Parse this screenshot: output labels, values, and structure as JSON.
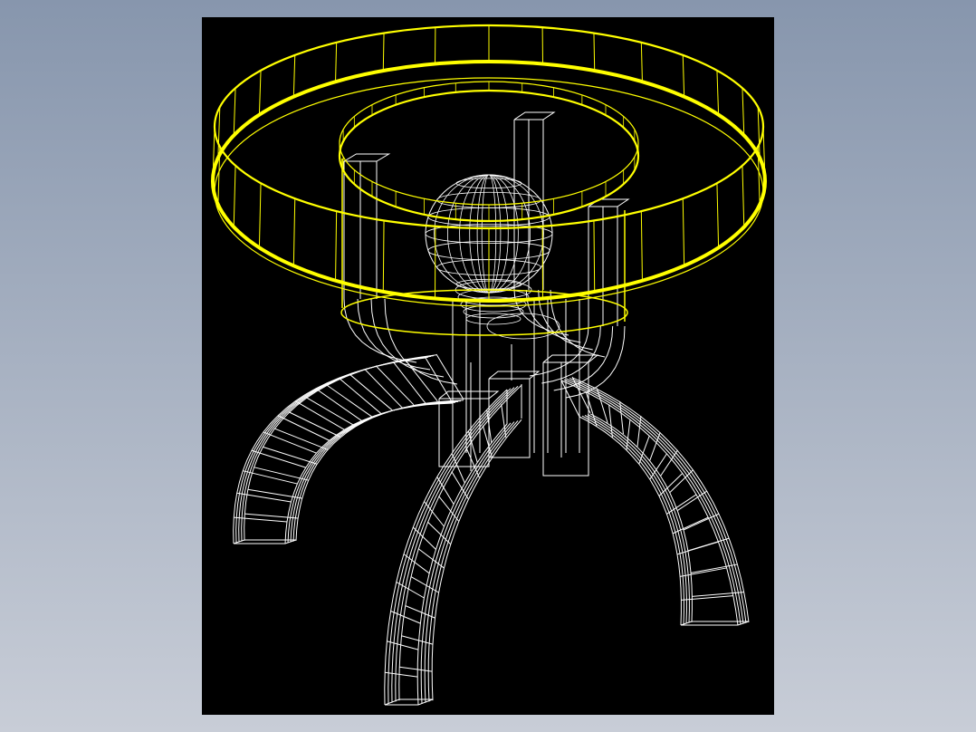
{
  "drawing": {
    "subject": "wireframe-round-side-table",
    "colors": {
      "background_top": "#8796ad",
      "background_bottom": "#c8cdd7",
      "viewport": "#000000",
      "wireframe": "#ffffff",
      "selection": "#ffff00"
    },
    "parts": [
      "glass-tabletop-ring",
      "inner-support-ring",
      "upright-posts",
      "center-ball-finial",
      "central-hub",
      "arched-legs"
    ]
  }
}
